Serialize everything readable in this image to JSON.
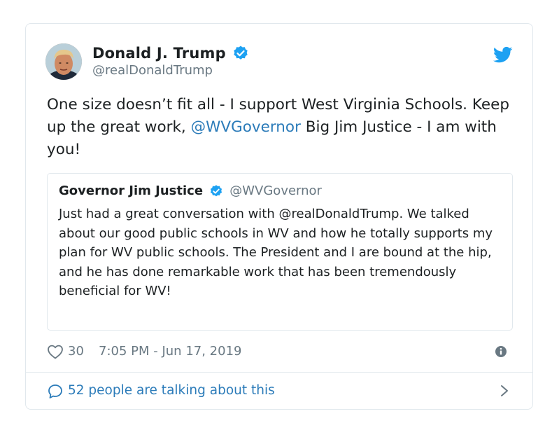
{
  "tweet": {
    "author": {
      "display_name": "Donald J. Trump",
      "handle": "@realDonaldTrump",
      "verified": true
    },
    "text_part1": "One size doesn’t fit all - I support West Virginia Schools. Keep up the great work, ",
    "mention": "@WVGovernor",
    "text_part2": " Big Jim Justice - I am with you!",
    "quoted": {
      "display_name": "Governor Jim Justice",
      "handle": "@WVGovernor",
      "verified": true,
      "text": "Just had a great conversation with @realDonaldTrump. We talked about our good public schools in WV and how he totally supports my plan for WV public schools. The President and I are bound at the hip, and he has done remarkable work that has been tremendously beneficial for WV!"
    },
    "likes": "30",
    "timestamp": "7:05 PM - Jun 17, 2019",
    "conversation_label": "52 people are talking about this"
  },
  "colors": {
    "twitter_blue": "#1da1f2",
    "link_blue": "#2b7bb9",
    "secondary_text": "#697882",
    "border": "#e1e8ed"
  },
  "icons": {
    "verified": "verified-badge-icon",
    "bird": "twitter-bird-icon",
    "heart": "heart-icon",
    "info": "info-icon",
    "bubble": "comment-bubble-icon",
    "chevron": "chevron-right-icon"
  }
}
